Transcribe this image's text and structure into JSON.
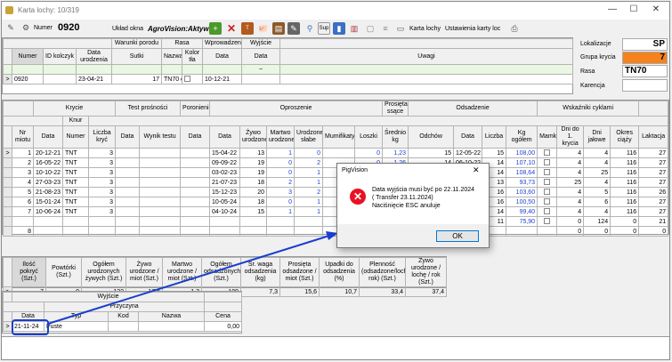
{
  "window": {
    "title": "Karta lochy: 10/319",
    "minimize": "—",
    "maximize": "☐",
    "close": "✕"
  },
  "toolbar": {
    "numer_label": "Numer",
    "numer_value": "0920",
    "uklad_label": "Układ okna",
    "uklad_value": "AgroVision:Aktywn",
    "karta_lochy": "Karta lochy",
    "ustawienia": "Ustawienia karty loc",
    "sup": "Sup"
  },
  "main_grid": {
    "group_headers": [
      "Warunki porodu",
      "Rasa",
      "Wprowadzenie",
      "Wyjście"
    ],
    "columns": [
      "Numer",
      "ID kolczyk",
      "Data urodzenia",
      "Sutki",
      "Nazwa",
      "Kolor tła",
      "Data",
      "Data",
      "Uwagi"
    ],
    "filter_mark": "~",
    "row": {
      "numer": "0920",
      "data_ur": "23-04-21",
      "sutki": "17",
      "rasa": "TN70 o",
      "wprow": "10-12-21"
    }
  },
  "side_panel": {
    "rows": [
      {
        "label": "Lokalizacje",
        "value": "SP"
      },
      {
        "label": "Grupa krycia",
        "value": "7"
      },
      {
        "label": "Rasa",
        "value": "TN70"
      },
      {
        "label": "Karencja",
        "value": ""
      }
    ],
    "accent": "#f5821f"
  },
  "cycles": {
    "groups": [
      "Krycie",
      "Test prośności",
      "Poronienie",
      "Oproszenie",
      "Prosięta ssące",
      "Odsadzenie",
      "Wskaźniki cyklami"
    ],
    "sub_knur": "Knur",
    "columns": [
      "Nr miotu",
      "Data",
      "Numer",
      "Liczba kryć",
      "Data",
      "Wynik testu",
      "Data",
      "Data",
      "Żywo urodzone",
      "Martwo urodzone",
      "Urodzone słabe",
      "Mumifikaty",
      "Loszki",
      "Średnio kg",
      "Odchów",
      "Data",
      "Liczba",
      "Kg ogółem",
      "Mamka",
      "Dni do 1. krycia",
      "Dni jałowe",
      "Okres ciąży",
      "Laktacja"
    ],
    "rows": [
      {
        "nr": "1",
        "k_data": "20-12-21",
        "knur": "TNT",
        "lk": "3",
        "o_data": "15-04-22",
        "zyw": "13",
        "mart": "1",
        "sl": "0",
        "mum": "",
        "losz": "0",
        "sr": "1,23",
        "odch": "15",
        "od_data": "12-05-22",
        "licz": "15",
        "kg": "108,00",
        "d1": "4",
        "dj": "4",
        "okr": "116",
        "lak": "27"
      },
      {
        "nr": "2",
        "k_data": "16-05-22",
        "knur": "TNT",
        "lk": "3",
        "o_data": "09-09-22",
        "zyw": "19",
        "mart": "0",
        "sl": "2",
        "mum": "",
        "losz": "0",
        "sr": "1,26",
        "odch": "14",
        "od_data": "06-10-22",
        "licz": "14",
        "kg": "107,10",
        "d1": "4",
        "dj": "4",
        "okr": "116",
        "lak": "27"
      },
      {
        "nr": "3",
        "k_data": "10-10-22",
        "knur": "TNT",
        "lk": "3",
        "o_data": "03-02-23",
        "zyw": "19",
        "mart": "0",
        "sl": "1",
        "mum": "",
        "losz": "",
        "sr": "",
        "odch": "",
        "od_data": "",
        "licz": "14",
        "kg": "108,64",
        "d1": "4",
        "dj": "25",
        "okr": "116",
        "lak": "27"
      },
      {
        "nr": "4",
        "k_data": "27-03-23",
        "knur": "TNT",
        "lk": "3",
        "o_data": "21-07-23",
        "zyw": "18",
        "mart": "2",
        "sl": "1",
        "mum": "",
        "losz": "",
        "sr": "",
        "odch": "",
        "od_data": "",
        "licz": "13",
        "kg": "93,73",
        "d1": "25",
        "dj": "4",
        "okr": "116",
        "lak": "27"
      },
      {
        "nr": "5",
        "k_data": "21-08-23",
        "knur": "TNT",
        "lk": "3",
        "o_data": "15-12-23",
        "zyw": "20",
        "mart": "3",
        "sl": "2",
        "mum": "",
        "losz": "",
        "sr": "",
        "odch": "",
        "od_data": "",
        "licz": "16",
        "kg": "103,60",
        "d1": "4",
        "dj": "5",
        "okr": "116",
        "lak": "26"
      },
      {
        "nr": "6",
        "k_data": "15-01-24",
        "knur": "TNT",
        "lk": "3",
        "o_data": "10-05-24",
        "zyw": "18",
        "mart": "0",
        "sl": "1",
        "mum": "",
        "losz": "",
        "sr": "",
        "odch": "",
        "od_data": "",
        "licz": "16",
        "kg": "100,50",
        "d1": "4",
        "dj": "6",
        "okr": "116",
        "lak": "27"
      },
      {
        "nr": "7",
        "k_data": "10-06-24",
        "knur": "TNT",
        "lk": "3",
        "o_data": "04-10-24",
        "zyw": "15",
        "mart": "1",
        "sl": "1",
        "mum": "",
        "losz": "",
        "sr": "",
        "odch": "",
        "od_data": "",
        "licz": "14",
        "kg": "99,40",
        "d1": "4",
        "dj": "4",
        "okr": "116",
        "lak": "27"
      },
      {
        "nr": "",
        "k_data": "",
        "knur": "",
        "lk": "",
        "o_data": "",
        "zyw": "",
        "mart": "",
        "sl": "",
        "mum": "",
        "losz": "",
        "sr": "",
        "odch": "",
        "od_data": "",
        "licz": "11",
        "kg": "75,90",
        "d1": "0",
        "dj": "124",
        "okr": "0",
        "lak": "21"
      },
      {
        "nr": "8",
        "k_data": "",
        "knur": "",
        "lk": "",
        "o_data": "",
        "zyw": "",
        "mart": "",
        "sl": "",
        "mum": "",
        "losz": "",
        "sr": "",
        "odch": "",
        "od_data": "",
        "licz": "",
        "kg": "",
        "d1": "0",
        "dj": "0",
        "okr": "0",
        "lak": "0"
      }
    ]
  },
  "summary": {
    "columns": [
      "Ilość pokryć (Szt.)",
      "Powtórki (Szt.)",
      "Ogółem urodzonych żywych (Szt.)",
      "Żywo urodzone / miot (Szt.)",
      "Martwo urodzone / miot (Szt.)",
      "Ogółem odsadzonych (Szt.)",
      "Śr. waga odsadzenia (kg)",
      "Prosięta odsadzone / miot (Szt.)",
      "Upadki do odsadzenia (%)",
      "Plenność (odsadzone/loche/ rok) (Szt.)",
      "Żywo urodzone / lochę / rok (Szt.)"
    ],
    "values": [
      "7",
      "0",
      "122",
      "17,4",
      "1,3",
      "109",
      "7,3",
      "15,6",
      "10,7",
      "33,4",
      "37,4"
    ]
  },
  "exit_grid": {
    "group": "Wyjście",
    "sub": "Przyczyna",
    "columns": [
      "Data",
      "Typ",
      "Kod",
      "Nazwa",
      "Cena"
    ],
    "row": {
      "data": "21-11-24",
      "typ": "Puste",
      "kod": "",
      "nazwa": "",
      "cena": "0,00"
    }
  },
  "dialog": {
    "title": "PigVision",
    "line1": "Data wyjścia musi być po 22.11.2024",
    "line2": "( Transfer 23.11.2024)",
    "line3": "Naciśnięcie ESC anuluje",
    "ok": "OK",
    "close": "✕"
  },
  "annotation_color": "#1a3fcf"
}
